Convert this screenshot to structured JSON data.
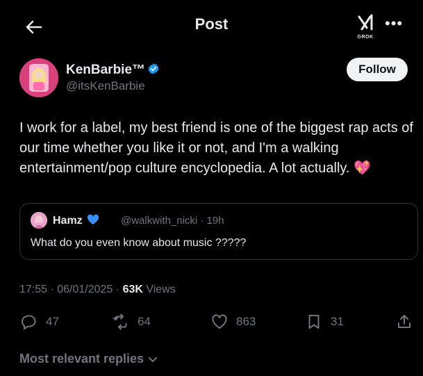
{
  "header": {
    "title": "Post",
    "grok_label": "GROK"
  },
  "author": {
    "display_name": "KenBarbie™",
    "handle": "@itsKenBarbie",
    "follow_label": "Follow"
  },
  "tweet": {
    "text": "I work for a label, my best friend is one of the biggest rap acts of our time whether you like it or not, and I'm a walking entertainment/pop culture encyclopedia. A lot actually.",
    "emoji": "💖"
  },
  "quote": {
    "name": "Hamz",
    "handle_time": "@walkwith_nicki · 19h",
    "text": "What do you even know about music ?????"
  },
  "meta": {
    "timestamp": "17:55 · 06/01/2025 · ",
    "views_count": "63K",
    "views_label": " Views"
  },
  "actions": {
    "replies": "47",
    "reposts": "64",
    "likes": "863",
    "bookmarks": "31"
  },
  "replies_section": {
    "label": "Most relevant replies"
  },
  "colors": {
    "background": "#000000",
    "text": "#e7e9ea",
    "muted": "#71767b",
    "verified": "#1d9bf0"
  }
}
